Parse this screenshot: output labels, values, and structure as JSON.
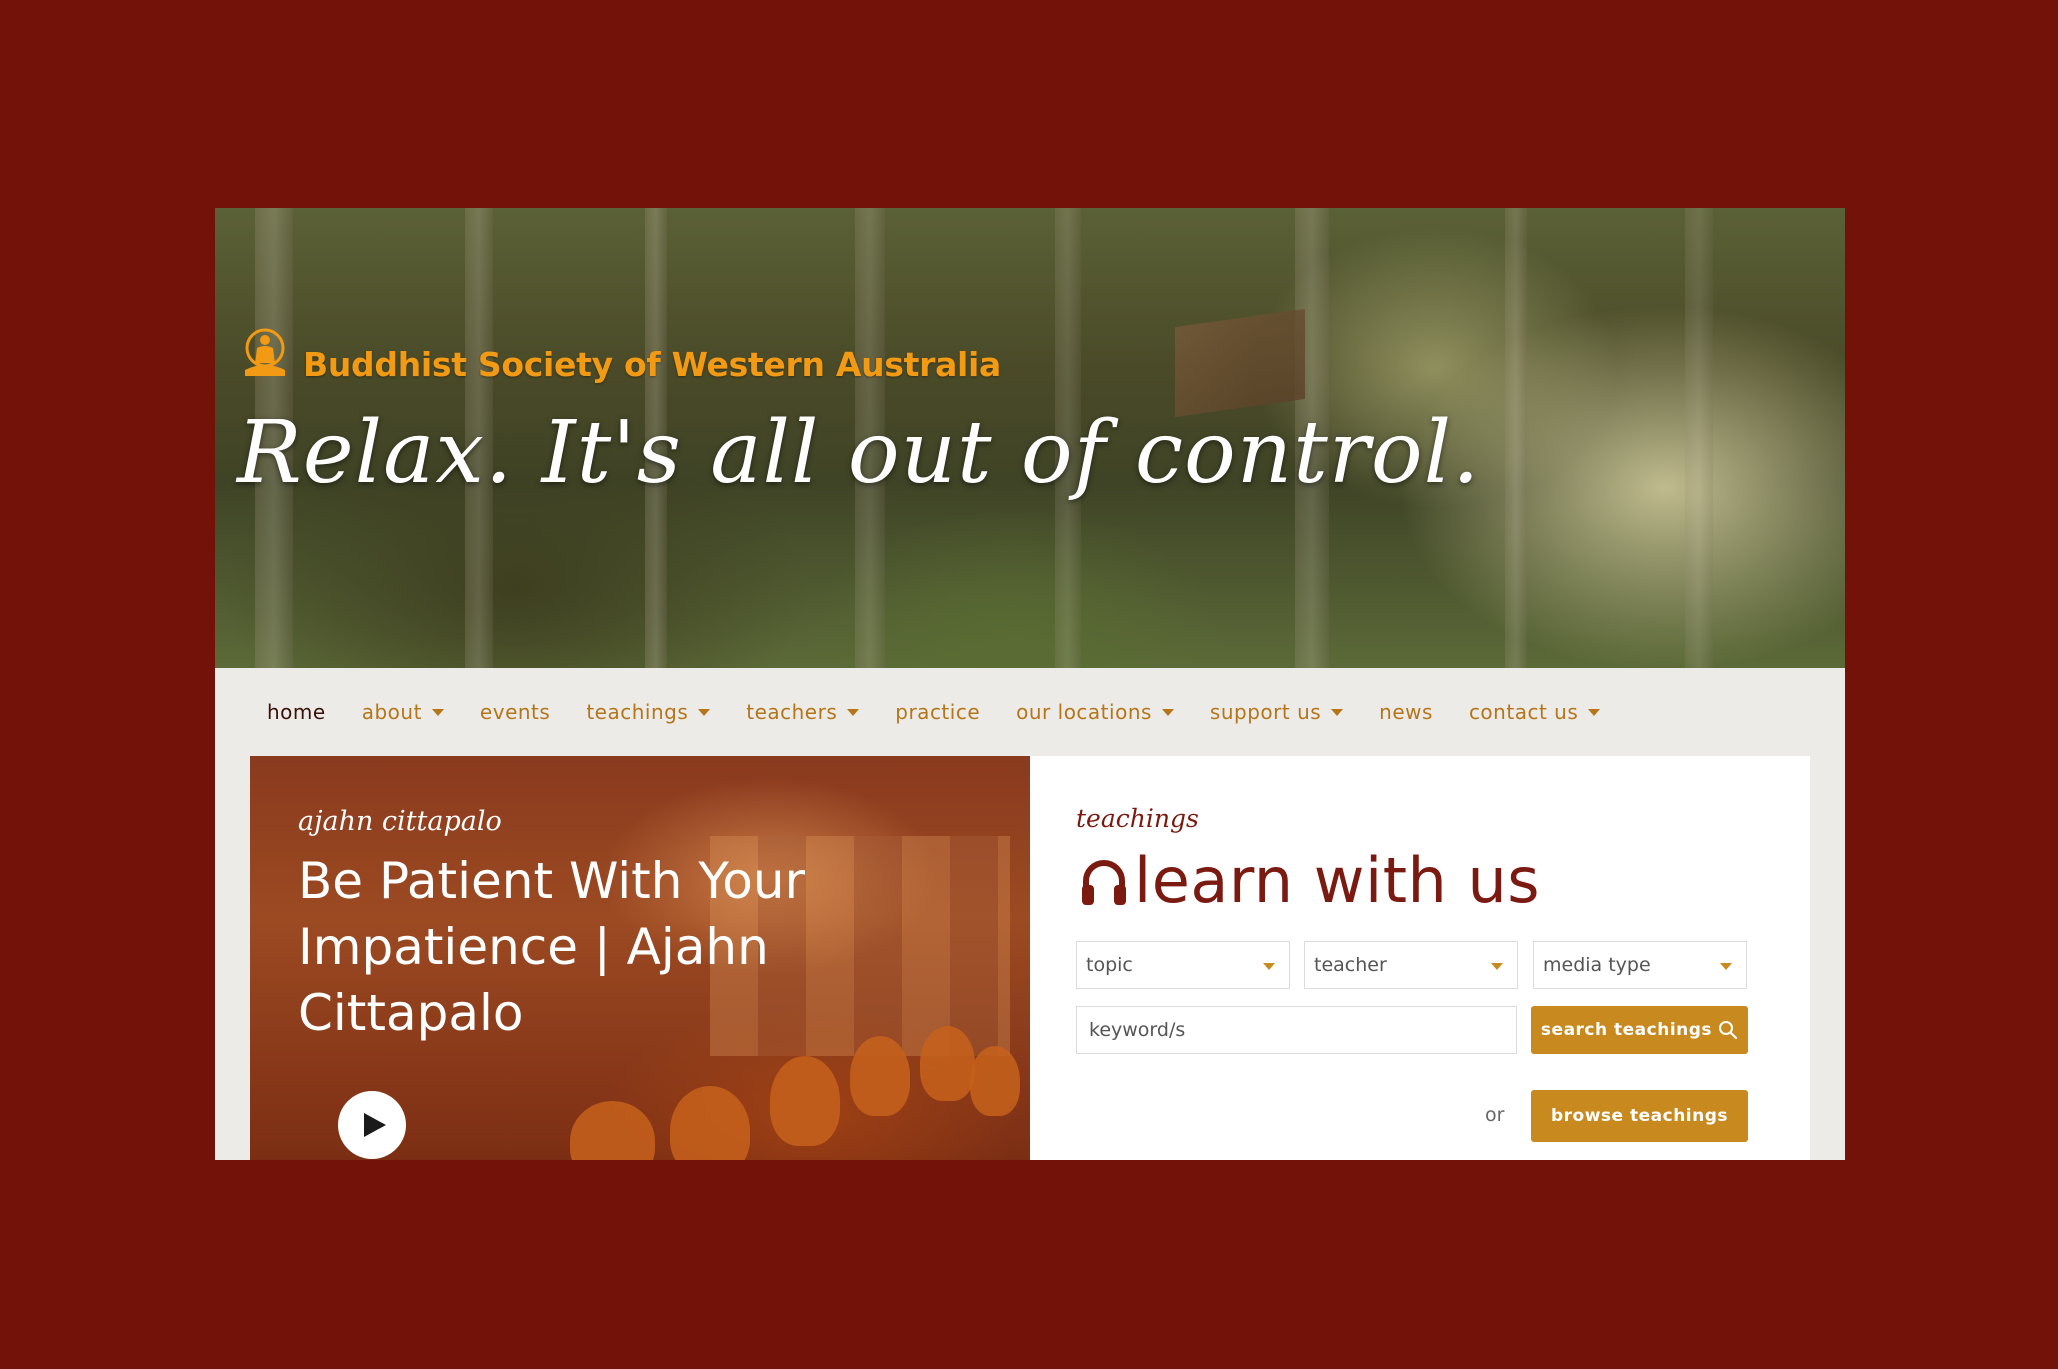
{
  "site": {
    "name": "Buddhist Society of Western Australia",
    "tagline": "Relax. It's all out of control.",
    "logo_icon": "meditating-buddha-icon",
    "brand_color": "#f29a14",
    "background_color": "#721208"
  },
  "nav": {
    "items": [
      {
        "label": "home",
        "dropdown": false,
        "active": true
      },
      {
        "label": "about",
        "dropdown": true
      },
      {
        "label": "events",
        "dropdown": false
      },
      {
        "label": "teachings",
        "dropdown": true
      },
      {
        "label": "teachers",
        "dropdown": true
      },
      {
        "label": "practice",
        "dropdown": false
      },
      {
        "label": "our locations",
        "dropdown": true
      },
      {
        "label": "support us",
        "dropdown": true
      },
      {
        "label": "news",
        "dropdown": false
      },
      {
        "label": "contact us",
        "dropdown": true
      }
    ],
    "link_color": "#b5761a"
  },
  "feature": {
    "author": "ajahn cittapalo",
    "title": "Be Patient With Your Impatience | Ajahn Cittapalo",
    "play_icon": "play-icon"
  },
  "teachings": {
    "label": "teachings",
    "heading": "learn with us",
    "heading_icon": "headphones-icon",
    "filters": {
      "topic": "topic",
      "teacher": "teacher",
      "media_type": "media type"
    },
    "keyword_placeholder": "keyword/s",
    "search_button": "search teachings",
    "or_text": "or",
    "browse_button": "browse teachings",
    "accent_color": "#c88a1e",
    "heading_color": "#7a1a10"
  }
}
